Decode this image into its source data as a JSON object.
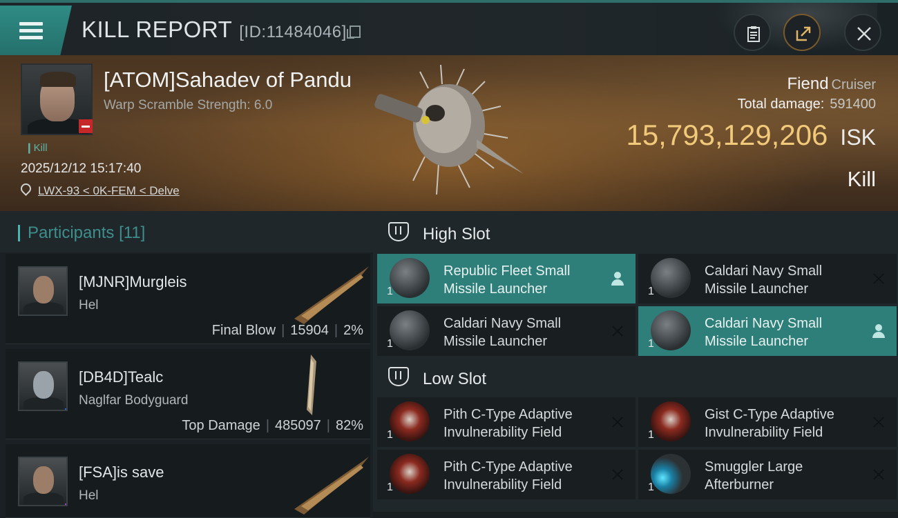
{
  "header": {
    "title": "KILL REPORT",
    "report_id": "[ID:11484046]"
  },
  "victim": {
    "name": "[ATOM]Sahadev of Pandu",
    "warp_scramble": "Warp Scramble Strength: 6.0",
    "tag": "Kill",
    "datetime": "2025/12/12 15:17:40",
    "location": "LWX-93 < 0K-FEM < Delve",
    "ship": "Fiend",
    "ship_class": "Cruiser",
    "total_damage_label": "Total damage:",
    "total_damage": "591400",
    "isk_value": "15,793,129,206",
    "isk_unit": "ISK",
    "result": "Kill"
  },
  "participants": {
    "label": "Participants",
    "count": "[11]",
    "rows": [
      {
        "name": "[MJNR]Murgleis",
        "ship": "Hel",
        "role": "Final Blow",
        "damage": "15904",
        "pct": "2%"
      },
      {
        "name": "[DB4D]Tealc",
        "ship": "Naglfar Bodyguard",
        "role": "Top Damage",
        "damage": "485097",
        "pct": "82%"
      },
      {
        "name": "[FSA]is save",
        "ship": "Hel",
        "role": "",
        "damage": "",
        "pct": ""
      }
    ]
  },
  "fitting": {
    "high_slot": "High Slot",
    "low_slot": "Low Slot",
    "high_modules": [
      {
        "name": "Republic Fleet Small Missile Launcher",
        "qty": "1"
      },
      {
        "name": "Caldari Navy Small Missile Launcher",
        "qty": "1"
      },
      {
        "name": "Caldari Navy Small Missile Launcher",
        "qty": "1"
      },
      {
        "name": "Caldari Navy Small Missile Launcher",
        "qty": "1"
      }
    ],
    "low_modules": [
      {
        "name": "Pith C-Type Adaptive Invulnerability Field",
        "qty": "1"
      },
      {
        "name": "Gist C-Type Adaptive Invulnerability Field",
        "qty": "1"
      },
      {
        "name": "Pith C-Type Adaptive Invulnerability Field",
        "qty": "1"
      },
      {
        "name": "Smuggler Large Afterburner",
        "qty": "1"
      }
    ]
  },
  "colors": {
    "accent": "#2e7f79",
    "isk_gold": "#f1c97a",
    "destroyed_x": "#0f1315"
  },
  "icons": [
    "menu-icon",
    "copy-icon",
    "clipboard-icon",
    "share-icon",
    "close-icon",
    "location-pin-icon",
    "high-slot-icon",
    "low-slot-icon",
    "remove-icon",
    "person-icon"
  ]
}
